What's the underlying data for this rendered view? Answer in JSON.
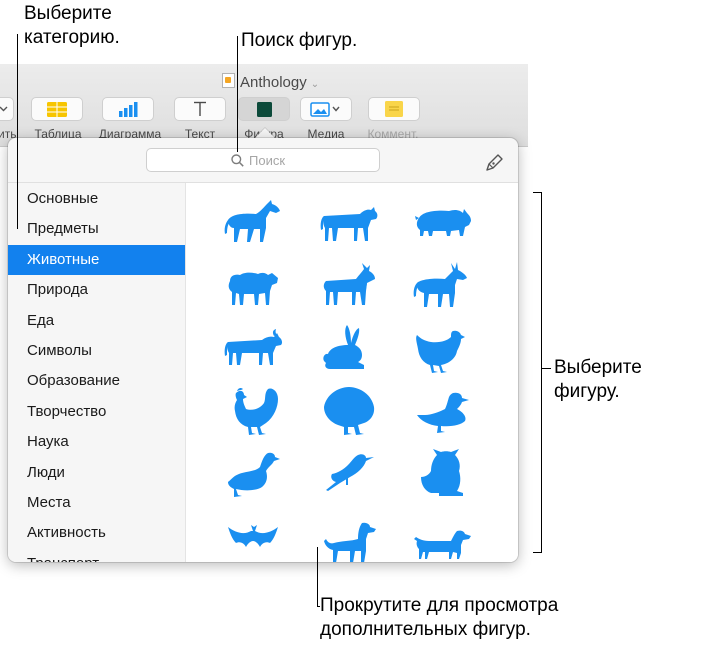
{
  "window": {
    "title": "Anthology",
    "toolbar": [
      {
        "id": "partial",
        "label": "ить",
        "icon": "chevron-down-icon"
      },
      {
        "id": "table",
        "label": "Таблица",
        "icon": "table-icon"
      },
      {
        "id": "chart",
        "label": "Диаграмма",
        "icon": "bar-chart-icon"
      },
      {
        "id": "text",
        "label": "Текст",
        "icon": "text-icon"
      },
      {
        "id": "shape",
        "label": "Фигура",
        "icon": "shape-icon"
      },
      {
        "id": "media",
        "label": "Медиа",
        "icon": "media-icon"
      },
      {
        "id": "comment",
        "label": "Коммент.",
        "icon": "comment-icon"
      }
    ]
  },
  "popover": {
    "search_placeholder": "Поиск",
    "categories": [
      "Основные",
      "Предметы",
      "Животные",
      "Природа",
      "Еда",
      "Символы",
      "Образование",
      "Творчество",
      "Наука",
      "Люди",
      "Места",
      "Активность",
      "Транспорт"
    ],
    "selected_category": "Животные",
    "shapes": [
      "horse",
      "cow",
      "pig",
      "sheep",
      "goat",
      "donkey",
      "bull",
      "rabbit",
      "hen",
      "rooster",
      "turkey",
      "duck",
      "goose",
      "bird",
      "owl",
      "bat",
      "dog",
      "dachshund"
    ]
  },
  "callouts": {
    "choose_category_line1": "Выберите",
    "choose_category_line2": "категорию.",
    "search_shapes": "Поиск фигур.",
    "choose_shape_line1": "Выберите",
    "choose_shape_line2": "фигуру.",
    "scroll_line1": "Прокрутите для просмотра",
    "scroll_line2": "дополнительных фигур."
  },
  "colors": {
    "accent": "#1281ee",
    "shape_fill": "#1a8ff0",
    "sidebar_bg": "#f6f6f6"
  }
}
